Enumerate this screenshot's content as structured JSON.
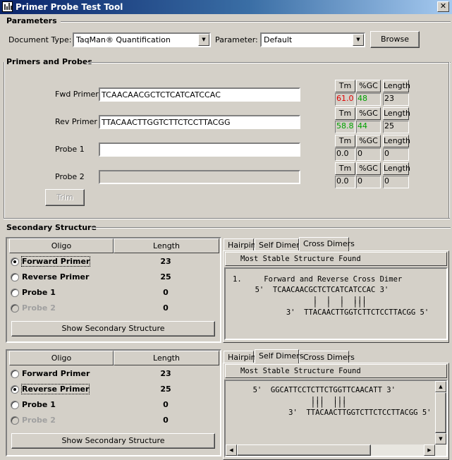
{
  "window": {
    "title": "Primer Probe Test Tool",
    "close_glyph": "✕"
  },
  "parameters": {
    "group_title": "Parameters",
    "document_type_label": "Document Type:",
    "document_type_value": "TaqMan® Quantification",
    "parameter_label": "Parameter:",
    "parameter_value": "Default",
    "browse_label": "Browse"
  },
  "primers": {
    "group_title": "Primers and Probes",
    "trim_label": "Trim",
    "col_headers": [
      "Tm",
      "%GC",
      "Length"
    ],
    "rows": [
      {
        "label": "Fwd Primer",
        "sequence": "TCAACAACGCTCTCATCATCCAC",
        "tm": "61.0",
        "gc": "48",
        "length": "23",
        "tm_color": "#e00000",
        "gc_color": "#00a000",
        "enabled": true
      },
      {
        "label": "Rev Primer",
        "sequence": "TTACAACTTGGTCTTCTCCTTACGG",
        "tm": "58.8",
        "gc": "44",
        "length": "25",
        "tm_color": "#00a000",
        "gc_color": "#00a000",
        "enabled": true
      },
      {
        "label": "Probe 1",
        "sequence": "",
        "tm": "0.0",
        "gc": "0",
        "length": "0",
        "tm_color": "#000000",
        "gc_color": "#000000",
        "enabled": true
      },
      {
        "label": "Probe 2",
        "sequence": "",
        "tm": "0.0",
        "gc": "0",
        "length": "0",
        "tm_color": "#000000",
        "gc_color": "#000000",
        "enabled": false
      }
    ]
  },
  "secondary": {
    "group_title": "Secondary Structure",
    "col_oligo": "Oligo",
    "col_length": "Length",
    "show_button": "Show Secondary Structure",
    "tabs": [
      "Hairpin",
      "Self Dimers",
      "Cross Dimers"
    ],
    "result_header": "Most Stable Structure Found",
    "panels": [
      {
        "oligos": [
          {
            "name": "Forward Primer",
            "length": "23",
            "checked": true,
            "disabled": false
          },
          {
            "name": "Reverse Primer",
            "length": "25",
            "checked": false,
            "disabled": false
          },
          {
            "name": "Probe 1",
            "length": "0",
            "checked": false,
            "disabled": false
          },
          {
            "name": "Probe 2",
            "length": "0",
            "checked": false,
            "disabled": true
          }
        ],
        "active_tab": "Cross Dimers",
        "result_lines": [
          "1.     Forward and Reverse Cross Dimer",
          "     5'  TCAACAACGCTCTCATCATCCAC 3'",
          "                  |  |  |  |||",
          "                  |  |  |  |||",
          "            3'  TTACAACTTGGTCTTCTCCTTACGG 5'"
        ]
      },
      {
        "oligos": [
          {
            "name": "Forward Primer",
            "length": "23",
            "checked": false,
            "disabled": false
          },
          {
            "name": "Reverse Primer",
            "length": "25",
            "checked": true,
            "disabled": false
          },
          {
            "name": "Probe 1",
            "length": "0",
            "checked": false,
            "disabled": false
          },
          {
            "name": "Probe 2",
            "length": "0",
            "checked": false,
            "disabled": true
          }
        ],
        "active_tab": "Self Dimers",
        "result_lines": [
          "     5'  GGCATTCCTCTTCTGGTTCAACATT 3'",
          "                  |||  |||",
          "                  |||  |||",
          "             3'  TTACAACTTGGTCTTCTCCTTACGG 5'"
        ]
      }
    ]
  }
}
